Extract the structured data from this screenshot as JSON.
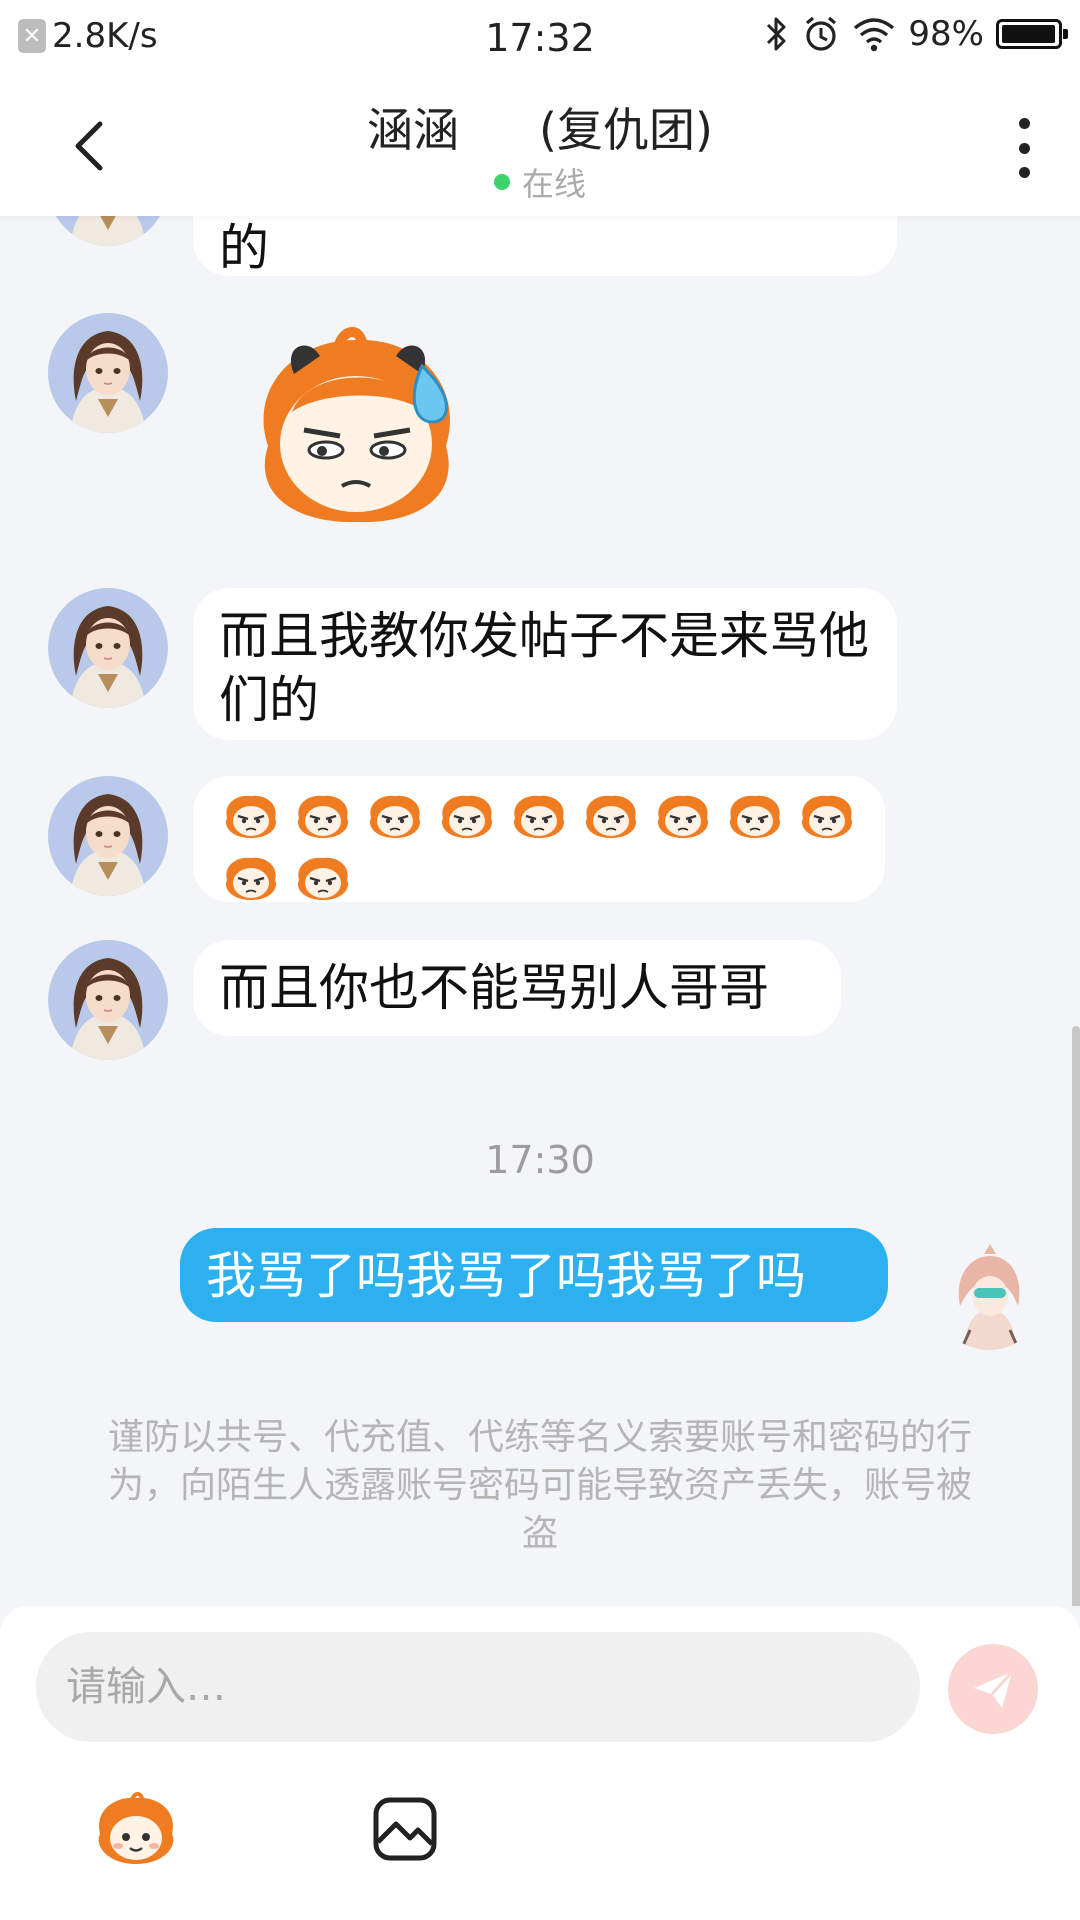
{
  "status_bar": {
    "net_speed": "2.8K/s",
    "time": "17:32",
    "battery": "98%",
    "battery_level": 0.98,
    "icons": [
      "close-badge-icon",
      "bluetooth-icon",
      "alarm-icon",
      "wifi-icon",
      "battery-icon"
    ]
  },
  "header": {
    "name": "涵涵",
    "group": "(复仇团)",
    "status": "在线",
    "status_color": "#3bd36a",
    "icons": [
      "back-arrow-icon",
      "more-vertical-icon"
    ]
  },
  "messages": [
    {
      "from": "other",
      "type": "text",
      "text": "的"
    },
    {
      "from": "other",
      "type": "sticker",
      "sticker": "sweat-cartoon-face-sticker"
    },
    {
      "from": "other",
      "type": "text",
      "text": "而且我教你发帖子不是来骂他们的"
    },
    {
      "from": "other",
      "type": "emoji",
      "emoji": "annoyed-face-emoji",
      "count": 11
    },
    {
      "from": "other",
      "type": "text",
      "text": "而且你也不能骂别人哥哥"
    },
    {
      "from": "me",
      "type": "text",
      "text": "我骂了吗我骂了吗我骂了吗"
    }
  ],
  "time_label": "17:30",
  "notice": "谨防以共号、代充值、代练等名义索要账号和密码的行为，向陌生人透露账号密码可能导致资产丢失，账号被盗",
  "input": {
    "placeholder": "请输入…"
  },
  "toolbar": {
    "icons": [
      "emoji-face-icon",
      "image-icon",
      "send-icon"
    ]
  },
  "colors": {
    "my_bubble": "#2cb0f0",
    "send_button": "#fbd6d2",
    "background": "#f4f5f8"
  }
}
